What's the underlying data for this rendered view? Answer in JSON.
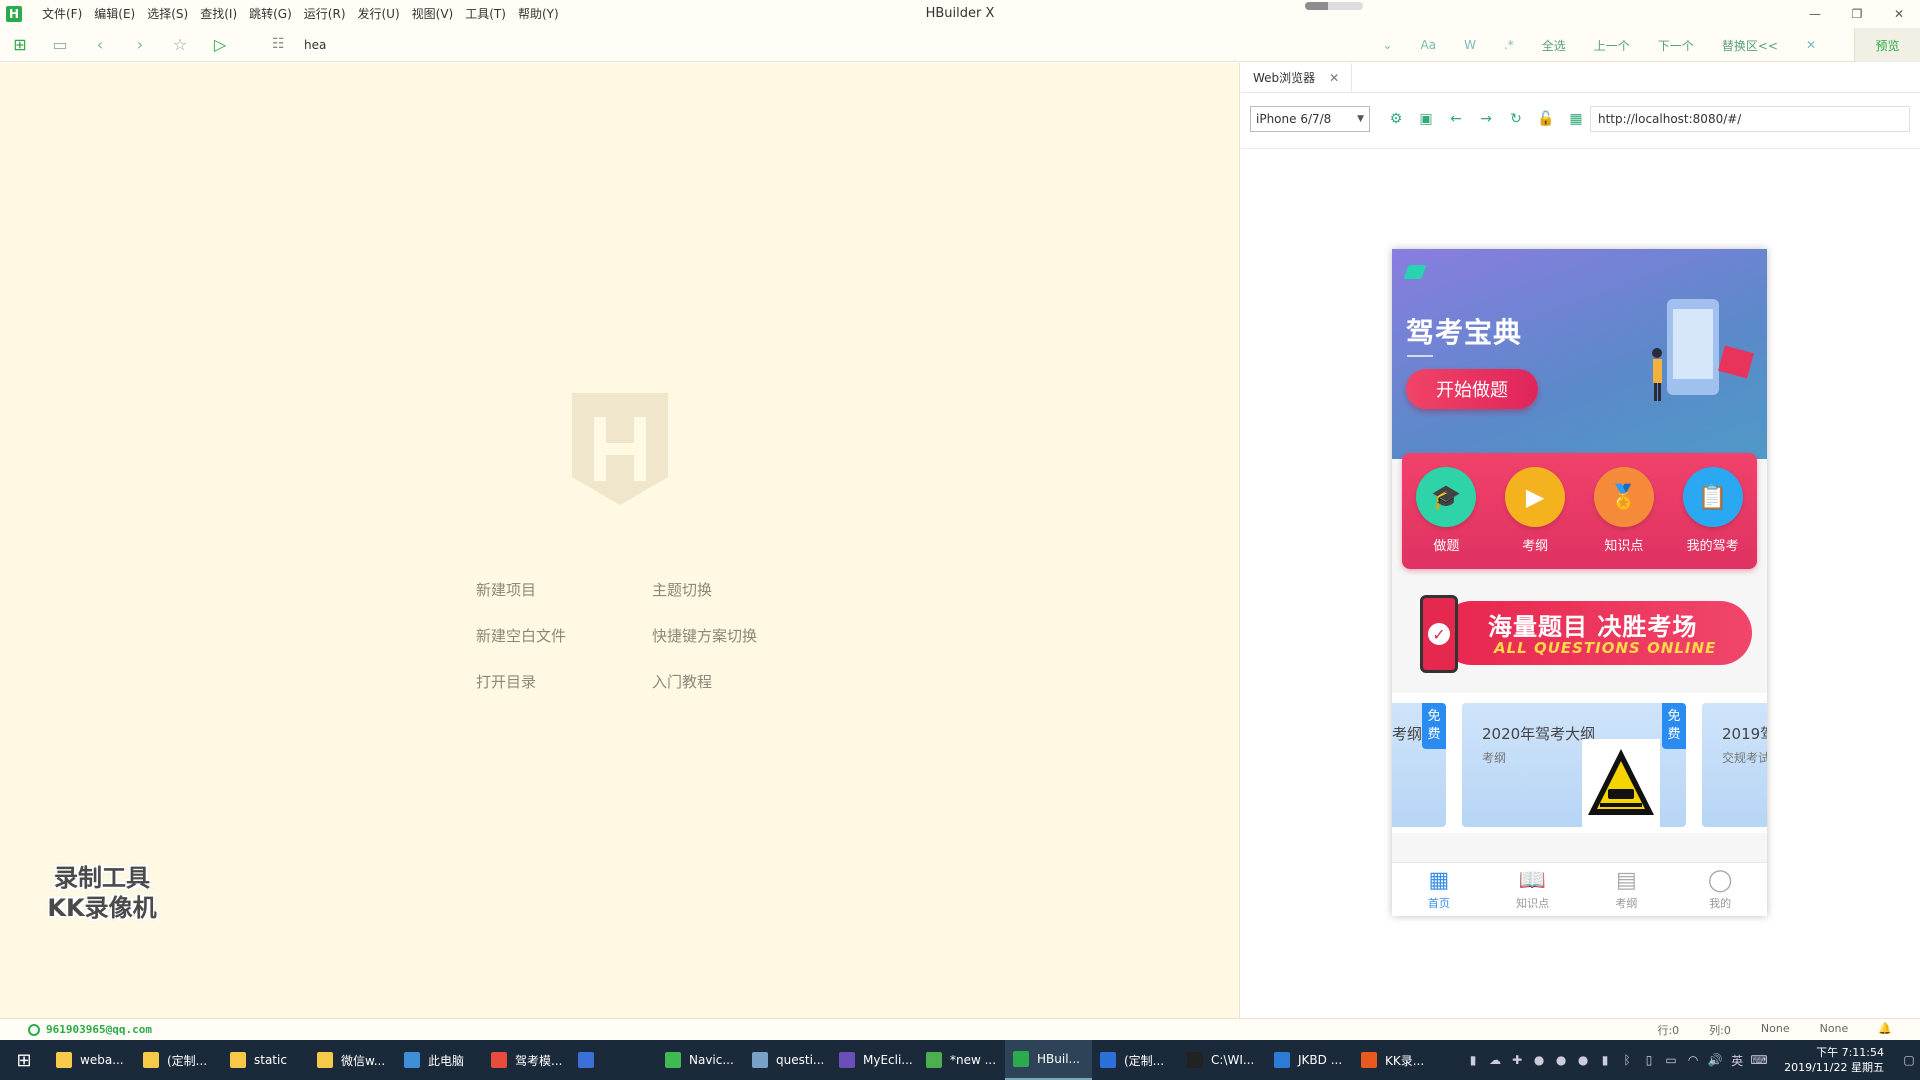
{
  "window": {
    "title": "HBuilder X",
    "logo": "H",
    "task_progress": 0.4,
    "controls": [
      "—",
      "❐",
      "✕"
    ]
  },
  "menu": [
    "文件(F)",
    "编辑(E)",
    "选择(S)",
    "查找(I)",
    "跳转(G)",
    "运行(R)",
    "发行(U)",
    "视图(V)",
    "工具(T)",
    "帮助(Y)"
  ],
  "toolbar": {
    "icons": [
      "new-file-icon",
      "save-icon",
      "back-icon",
      "forward-icon",
      "star-icon",
      "run-icon"
    ],
    "search_value": "hea",
    "find_tools": {
      "chevron": "⌄",
      "case": "Aa",
      "word": "W",
      "regex": ".*",
      "select_all": "全选",
      "prev": "上一个",
      "next": "下一个",
      "replace": "替换区<<",
      "close": "✕"
    },
    "preview": "预览"
  },
  "editor": {
    "quick_links": [
      "新建项目",
      "主题切换",
      "新建空白文件",
      "快捷键方案切换",
      "打开目录",
      "入门教程"
    ],
    "watermark_line1": "录制工具",
    "watermark_line2": "KK录像机"
  },
  "browser": {
    "tab_label": "Web浏览器",
    "tab_close": "✕",
    "device": "iPhone 6/7/8",
    "url": "http://localhost:8080/#/",
    "nav_icons": [
      "settings-icon",
      "screenshot-icon",
      "back-icon",
      "forward-icon",
      "refresh-icon",
      "lock-icon",
      "qr-icon"
    ]
  },
  "app": {
    "brand": "驾考宝典",
    "start_button": "开始做题",
    "icons": [
      {
        "label": "做题",
        "icon": "graduation-cap-icon",
        "glyph": "🎓",
        "color": "#2fd3a8"
      },
      {
        "label": "考纲",
        "icon": "video-icon",
        "glyph": "▶",
        "color": "#f5b21f"
      },
      {
        "label": "知识点",
        "icon": "medal-icon",
        "glyph": "🏅",
        "color": "#f58a3a"
      },
      {
        "label": "我的驾考",
        "icon": "list-icon",
        "glyph": "📋",
        "color": "#2aa8f2"
      }
    ],
    "promo_title": "海量题目 决胜考场",
    "promo_sub": "ALL QUESTIONS ONLINE",
    "cards": [
      {
        "title": "考纲",
        "sub": "",
        "badge": "免费"
      },
      {
        "title": "2020年驾考大纲",
        "sub": "考纲",
        "badge": "免费"
      },
      {
        "title": "2019驾",
        "sub": "交规考试",
        "badge": ""
      }
    ],
    "tabs": [
      {
        "label": "首页",
        "icon": "home-icon",
        "glyph": "▦",
        "active": true
      },
      {
        "label": "知识点",
        "icon": "book-icon",
        "glyph": "📖",
        "active": false
      },
      {
        "label": "考纲",
        "icon": "document-icon",
        "glyph": "▤",
        "active": false
      },
      {
        "label": "我的",
        "icon": "user-icon",
        "glyph": "◯",
        "active": false
      }
    ]
  },
  "status": {
    "account": "961903965@qq.com",
    "line": "行:0",
    "col": "列:0",
    "enc": "None",
    "type": "None"
  },
  "taskbar": {
    "items": [
      {
        "label": "weba...",
        "color": "#f7c948"
      },
      {
        "label": "(定制...",
        "color": "#f7c948"
      },
      {
        "label": "static",
        "color": "#f7c948"
      },
      {
        "label": "微信w...",
        "color": "#f7c948"
      },
      {
        "label": "此电脑",
        "color": "#3d8fd8"
      },
      {
        "label": "驾考模...",
        "color": "#e94b3c"
      },
      {
        "label": "",
        "color": "#3d6fd8"
      },
      {
        "label": "Navic...",
        "color": "#3fb950"
      },
      {
        "label": "questi...",
        "color": "#7aa0c8"
      },
      {
        "label": "MyEcli...",
        "color": "#6b4fb8"
      },
      {
        "label": "*new ...",
        "color": "#4caf50"
      },
      {
        "label": "HBuil...",
        "color": "#2bab4b",
        "active": true
      },
      {
        "label": "(定制...",
        "color": "#2b6fd8"
      },
      {
        "label": "C:\\WI...",
        "color": "#222"
      },
      {
        "label": "JKBD ...",
        "color": "#2c7bd6"
      },
      {
        "label": "KK录...",
        "color": "#e85a1f"
      }
    ],
    "ime": "英",
    "time": "下午 7:11:54",
    "date": "2019/11/22 星期五"
  }
}
